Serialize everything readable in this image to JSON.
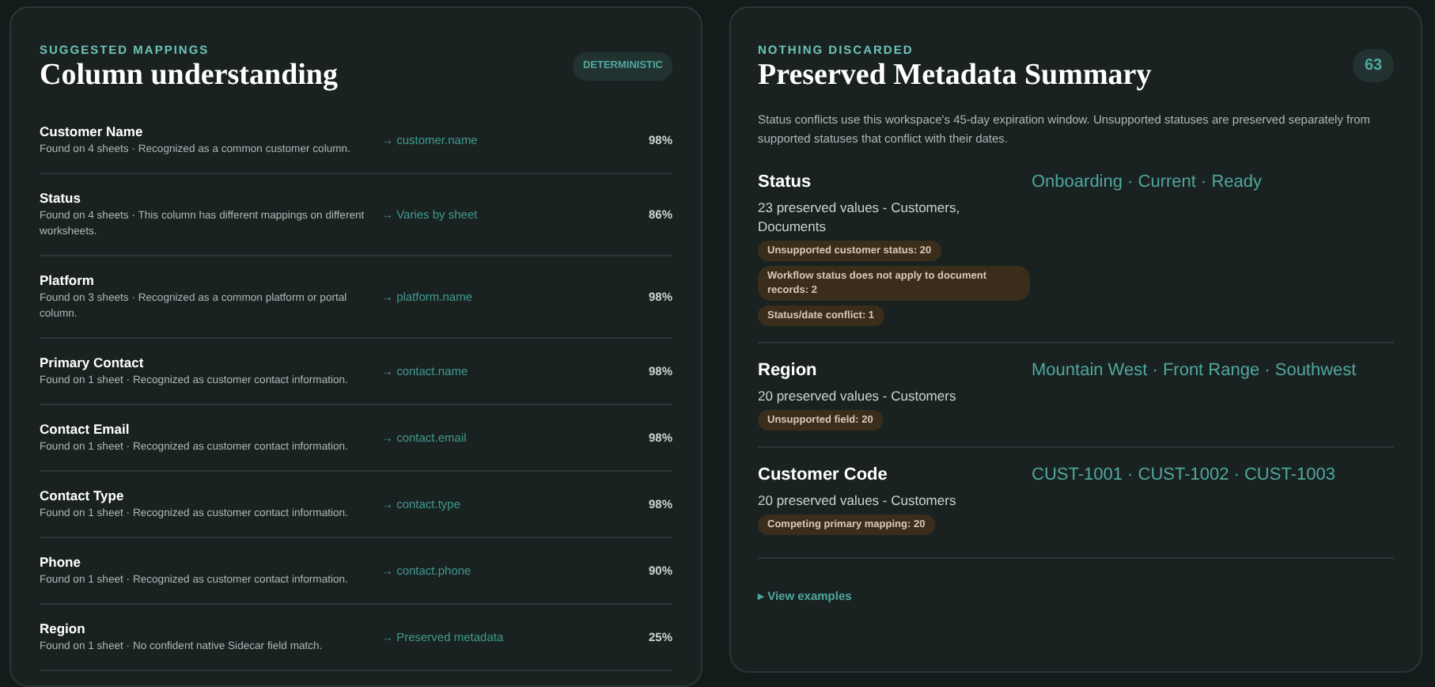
{
  "mappings": {
    "eyebrow": "SUGGESTED MAPPINGS",
    "title": "Column understanding",
    "badge": "DETERMINISTIC",
    "rows": [
      {
        "name": "Customer Name",
        "detail": "Found on 4 sheets · Recognized as a common customer column.",
        "target": "→ customer.name",
        "confidence": "98%"
      },
      {
        "name": "Status",
        "detail": "Found on 4 sheets · This column has different mappings on different worksheets.",
        "target": "→ Varies by sheet",
        "confidence": "86%"
      },
      {
        "name": "Platform",
        "detail": "Found on 3 sheets · Recognized as a common platform or portal column.",
        "target": "→ platform.name",
        "confidence": "98%"
      },
      {
        "name": "Primary Contact",
        "detail": "Found on 1 sheet · Recognized as customer contact information.",
        "target": "→ contact.name",
        "confidence": "98%"
      },
      {
        "name": "Contact Email",
        "detail": "Found on 1 sheet · Recognized as customer contact information.",
        "target": "→ contact.email",
        "confidence": "98%"
      },
      {
        "name": "Contact Type",
        "detail": "Found on 1 sheet · Recognized as customer contact information.",
        "target": "→ contact.type",
        "confidence": "98%"
      },
      {
        "name": "Phone",
        "detail": "Found on 1 sheet · Recognized as customer contact information.",
        "target": "→ contact.phone",
        "confidence": "90%"
      },
      {
        "name": "Region",
        "detail": "Found on 1 sheet · No confident native Sidecar field match.",
        "target": "→ Preserved metadata",
        "confidence": "25%"
      }
    ]
  },
  "summary": {
    "eyebrow": "NOTHING DISCARDED",
    "title": "Preserved Metadata Summary",
    "count": "63",
    "note": "Status conflicts use this workspace's 45-day expiration window. Unsupported statuses are preserved separately from supported statuses that conflict with their dates.",
    "fields": [
      {
        "name": "Status",
        "meta": "23 preserved values - Customers, Documents",
        "examples": "Onboarding · Current · Ready",
        "tags": [
          "Unsupported customer status: 20",
          "Workflow status does not apply to document records: 2",
          "Status/date conflict: 1"
        ]
      },
      {
        "name": "Region",
        "meta": "20 preserved values - Customers",
        "examples": "Mountain West · Front Range · Southwest",
        "tags": [
          "Unsupported field: 20"
        ]
      },
      {
        "name": "Customer Code",
        "meta": "20 preserved values - Customers",
        "examples": "CUST-1001 · CUST-1002 · CUST-1003",
        "tags": [
          "Competing primary mapping: 20"
        ]
      }
    ],
    "link": "▸ View examples"
  }
}
